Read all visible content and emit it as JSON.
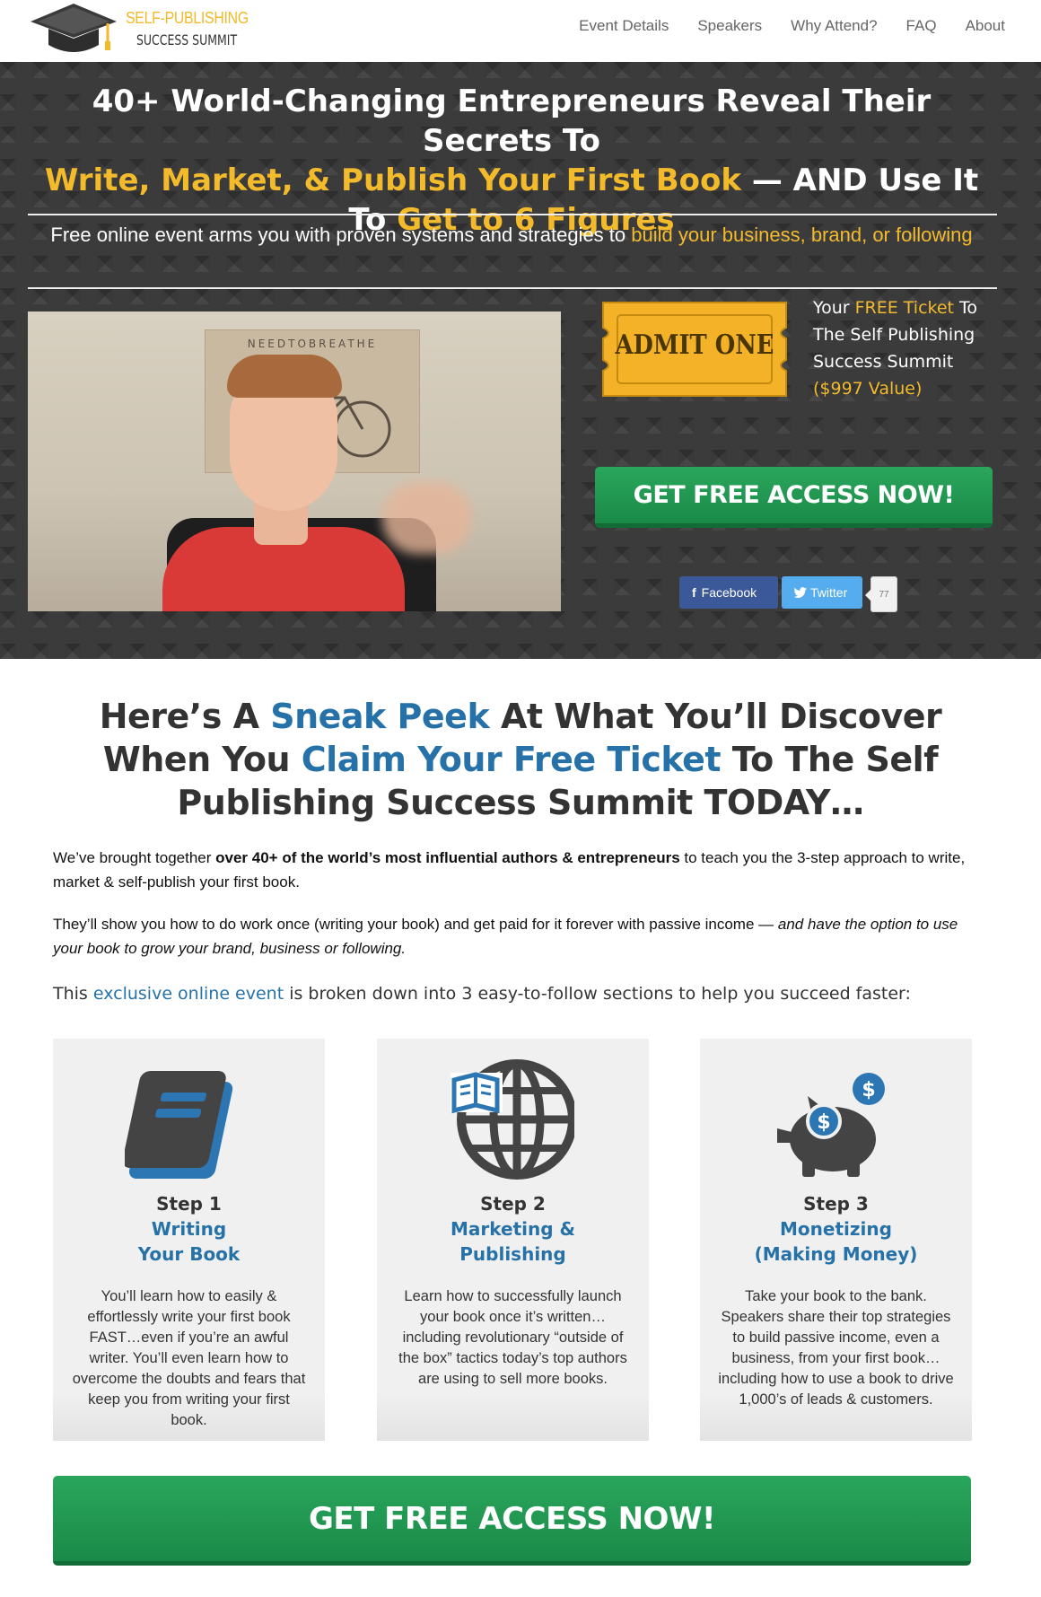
{
  "header": {
    "logo": {
      "line1": "SELF-PUBLISHING",
      "line2": "SUCCESS SUMMIT"
    },
    "nav": [
      "Event Details",
      "Speakers",
      "Why Attend?",
      "FAQ",
      "About"
    ]
  },
  "hero": {
    "headline": {
      "part1": "40+ World-Changing Entrepreneurs Reveal Their Secrets To",
      "part2_highlight": "Write, Market, & Publish Your First Book",
      "part3": " — AND Use It To ",
      "part4_highlight": "Get to 6 Figures"
    },
    "subheadline": {
      "text": "Free online event arms you with proven systems and strategies to ",
      "highlight": "build your business, brand, or following"
    },
    "video": {
      "poster_text": "NEEDTOBREATHE"
    },
    "ticket": {
      "label": "ADMIT ONE",
      "caption_1": "Your ",
      "caption_highlight": "FREE Ticket",
      "caption_2": " To The Self Publishing Success Summit",
      "caption_value": "($997 Value)"
    },
    "cta_label": "GET FREE ACCESS NOW!",
    "share": {
      "facebook": "Facebook",
      "twitter": "Twitter",
      "count": "77"
    }
  },
  "section": {
    "title": {
      "a": "Here’s A ",
      "b": "Sneak Peek",
      "c": " At What You’ll Discover When You ",
      "d": "Claim Your Free Ticket",
      "e": " To The Self Publishing Success Summit TODAY…"
    },
    "para1": {
      "a": "We’ve brought together ",
      "bold": "over 40+ of the world’s most influential authors & entrepreneurs",
      "b": " to teach you the 3-step approach to write, market & self-publish your first book."
    },
    "para2": {
      "a": "They’ll show you how to do work once (writing your book) and get paid for it forever with passive income — ",
      "italic": "and have the option to use your book to grow your brand, business or following."
    },
    "para3": {
      "a": "This ",
      "link": "exclusive online event",
      "b": " is broken down into 3 easy-to-follow sections to help you succeed faster:"
    },
    "steps": [
      {
        "icon": "book-icon",
        "step": "Step 1",
        "title1": "Writing",
        "title2": "Your Book",
        "text": "You’ll learn how to easily & effortlessly write your first book FAST…even if you’re an awful writer. You’ll even learn how to overcome the doubts and fears that keep you from writing your first book."
      },
      {
        "icon": "globe-book-icon",
        "step": "Step 2",
        "title1": "Marketing &",
        "title2": "Publishing",
        "text": "Learn how to successfully launch your book once it’s written…including revolutionary “outside of the box” tactics today’s top authors are using to sell more books."
      },
      {
        "icon": "piggy-bank-icon",
        "step": "Step 3",
        "title1": "Monetizing",
        "title2": "(Making Money)",
        "text": "Take your book to the bank. Speakers share their top strategies to build passive income, even a business, from your first book… including how to use a book to drive 1,000’s of leads & customers."
      }
    ],
    "cta_label": "GET FREE ACCESS NOW!"
  },
  "colors": {
    "accent_yellow": "#f3bb2c",
    "accent_blue": "#2672a8",
    "cta_green": "#1f9a51",
    "hero_bg": "#3b3b3b"
  }
}
